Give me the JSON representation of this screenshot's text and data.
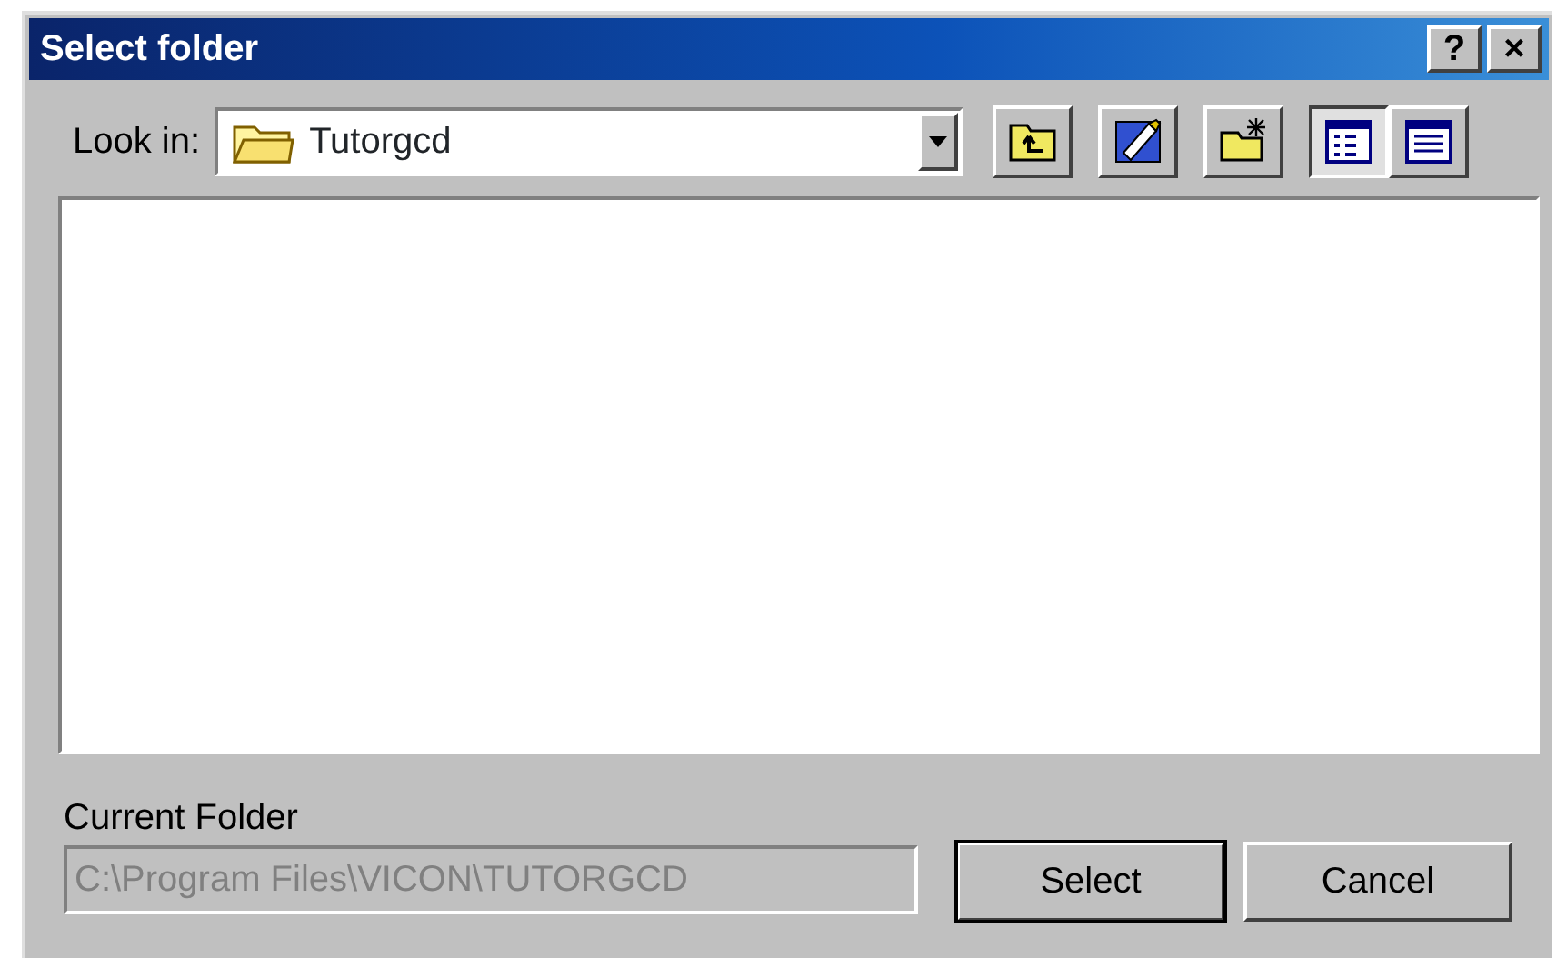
{
  "window": {
    "title": "Select folder",
    "title_buttons": [
      {
        "label": "?"
      },
      {
        "label": "×"
      }
    ]
  },
  "look_in": {
    "label": "Look in:",
    "value": "Tutorgcd"
  },
  "toolbar": [
    {
      "kind": "up",
      "selected": false
    },
    {
      "kind": "edit",
      "selected": false
    },
    {
      "kind": "new-folder",
      "selected": false
    },
    {
      "kind": "list-view",
      "selected": true
    },
    {
      "kind": "details-view",
      "selected": false
    }
  ],
  "current_folder": {
    "label": "Current Folder",
    "value": "C:\\Program Files\\VICON\\TUTORGCD",
    "disabled": true
  },
  "buttons": [
    {
      "label": "Select",
      "default": true
    },
    {
      "label": "Cancel",
      "default": false
    }
  ]
}
